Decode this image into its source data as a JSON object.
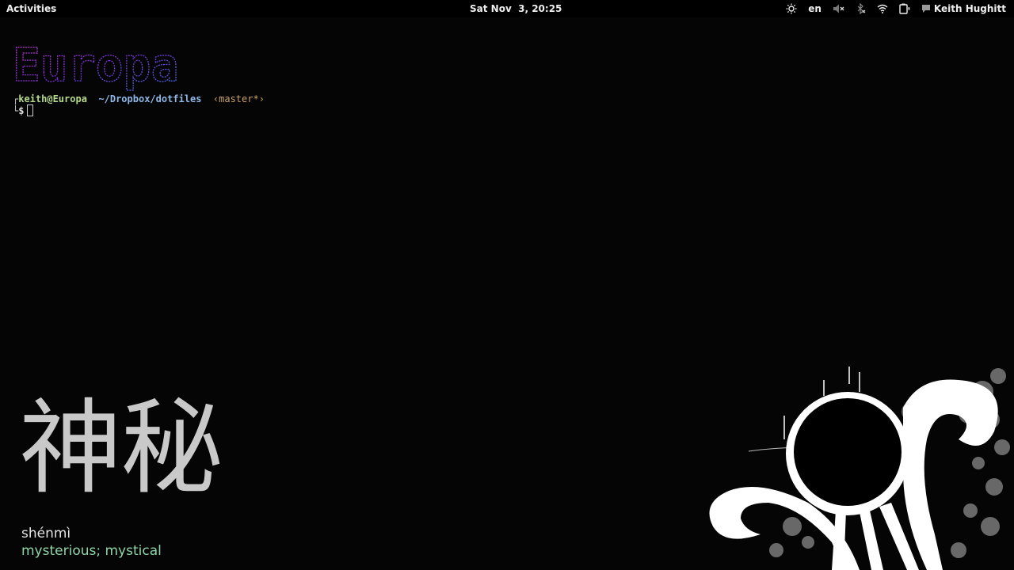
{
  "topbar": {
    "activities_label": "Activities",
    "clock": "Sat Nov  3, 20:25",
    "tray": {
      "brightness_icon": "sun-icon",
      "language": "en",
      "volume_icon": "speaker-muted-icon",
      "bluetooth_icon": "bluetooth-off-icon",
      "wifi_icon": "wifi-icon",
      "battery_icon": "battery-charging-icon",
      "user_icon": "chat-bubble-icon",
      "user_name": "Keith Hughitt"
    }
  },
  "terminal": {
    "banner_text": "Europa",
    "prompt": {
      "user_host": "keith@Europa",
      "path": "~/Dropbox/dotfiles",
      "branch": "‹master*›",
      "symbol": "$"
    }
  },
  "wallpaper": {
    "hanzi": "神秘",
    "pinyin": "shénmì",
    "meaning": "mysterious; mystical"
  },
  "colors": {
    "background": "#050505",
    "user_host": "#b5d98a",
    "path": "#8fb8e8",
    "branch": "#c9a26a",
    "meaning": "#8ed6a8",
    "banner_gradient": [
      "#c23bd6",
      "#7a2fd0",
      "#3b6fe0"
    ]
  }
}
